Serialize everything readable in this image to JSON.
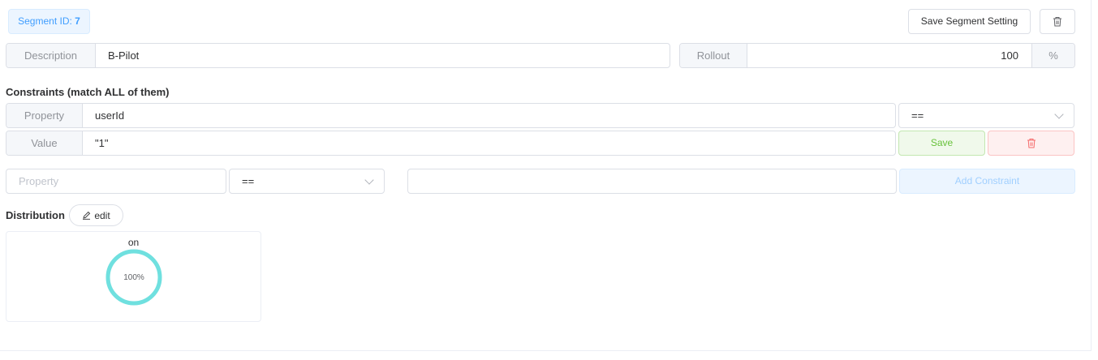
{
  "segment": {
    "id_label": "Segment ID:",
    "id_value": "7",
    "save_label": "Save Segment Setting"
  },
  "description": {
    "label": "Description",
    "value": "B-Pilot"
  },
  "rollout": {
    "label": "Rollout",
    "value": "100",
    "unit": "%"
  },
  "constraints": {
    "title": "Constraints (match ALL of them)",
    "items": [
      {
        "property_label": "Property",
        "property": "userId",
        "operator": "==",
        "value_label": "Value",
        "value": "\"1\"",
        "save_label": "Save"
      }
    ],
    "new": {
      "property_placeholder": "Property",
      "operator": "==",
      "value_placeholder": "",
      "add_label": "Add Constraint"
    }
  },
  "distribution": {
    "title": "Distribution",
    "edit_label": "edit",
    "variants": [
      {
        "name": "on",
        "percent": 100,
        "percent_label": "100%",
        "color": "#6fe0df"
      }
    ]
  },
  "colors": {
    "accent": "#409eff",
    "success": "#67c23a",
    "danger": "#f56c6c",
    "ring": "#6fe0df"
  }
}
